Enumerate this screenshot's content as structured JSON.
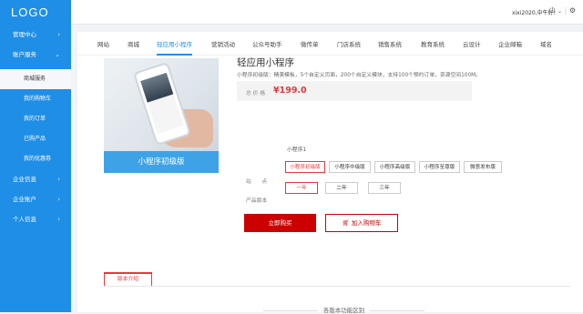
{
  "sidebar": {
    "logo": "LOGO",
    "items": [
      {
        "label": "管理中心"
      },
      {
        "label": "账户服务"
      },
      {
        "label": "商城服务"
      },
      {
        "label": "我的购物车"
      },
      {
        "label": "我的订单"
      },
      {
        "label": "已购产品"
      },
      {
        "label": "我的优惠券"
      },
      {
        "label": "企业信息"
      },
      {
        "label": "企业账户"
      },
      {
        "label": "个人信息"
      }
    ]
  },
  "header": {
    "user_greeting": "xixi2020,中午好!"
  },
  "tabs": [
    "网站",
    "商城",
    "轻应用小程序",
    "营销活动",
    "公众号助手",
    "微传单",
    "门店系统",
    "销售系统",
    "教育系统",
    "云设计",
    "企业邮箱",
    "域名"
  ],
  "product": {
    "image_caption": "小程序初级版",
    "title": "轻应用小程序",
    "description": "小程序初级版：精美模板，5个自定义页面，200个自定义模块，支持100个预约订单，资源空间100M。",
    "price_label": "总 价 格",
    "price": "¥199.0",
    "site_label": "站　　点",
    "site_value": "小程序1",
    "version_label": "产品版本",
    "versions": [
      "小程序初级版",
      "小程序中级版",
      "小程序高级版",
      "小程序至尊版",
      "微意发布版"
    ],
    "year_label": "年　　份",
    "years": [
      "一年",
      "二年",
      "三年"
    ],
    "buy_label": "立即购买",
    "cart_label": "加入购物车"
  },
  "intro": {
    "tab_label": "版本介绍",
    "section_title": "各版本功能区别"
  },
  "colors": {
    "sidebar": "#1f8ee6",
    "accent": "#e4393c",
    "buy_button": "#cc0000"
  }
}
